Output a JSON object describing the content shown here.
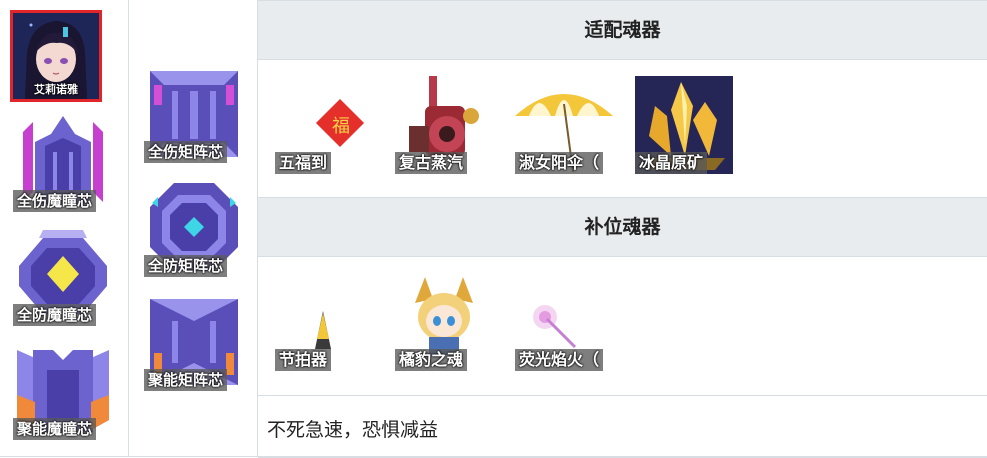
{
  "character": {
    "name": "艾莉诺雅"
  },
  "left_cores": [
    {
      "label": "全伤魔瞳芯",
      "icon": "full-damage-demon-eye-core-icon"
    },
    {
      "label": "全防魔瞳芯",
      "icon": "full-defense-demon-eye-core-icon"
    },
    {
      "label": "聚能魔瞳芯",
      "icon": "energy-demon-eye-core-icon"
    }
  ],
  "matrix_cores": [
    {
      "label": "全伤矩阵芯",
      "icon": "full-damage-matrix-core-icon"
    },
    {
      "label": "全防矩阵芯",
      "icon": "full-defense-matrix-core-icon"
    },
    {
      "label": "聚能矩阵芯",
      "icon": "energy-matrix-core-icon"
    }
  ],
  "sections": {
    "adapted": {
      "title": "适配魂器",
      "items": [
        {
          "label": "五福到",
          "icon": "five-blessings-icon"
        },
        {
          "label": "复古蒸汽",
          "icon": "retro-steam-engine-icon"
        },
        {
          "label": "淑女阳伞（",
          "icon": "lady-parasol-icon"
        },
        {
          "label": "冰晶原矿",
          "icon": "ice-crystal-ore-icon"
        }
      ]
    },
    "substitute": {
      "title": "补位魂器",
      "items": [
        {
          "label": "节拍器",
          "icon": "metronome-icon"
        },
        {
          "label": "橘豹之魂",
          "icon": "orange-leopard-soul-icon"
        },
        {
          "label": "荧光焰火（",
          "icon": "fluorescent-firework-icon"
        }
      ]
    }
  },
  "footer_note": "不死急速，恐惧减益",
  "colors": {
    "header_bg": "#e8ecef",
    "border": "#d8dde3",
    "portrait_border": "#e0262b",
    "core_purple": "#7b6fd6"
  }
}
